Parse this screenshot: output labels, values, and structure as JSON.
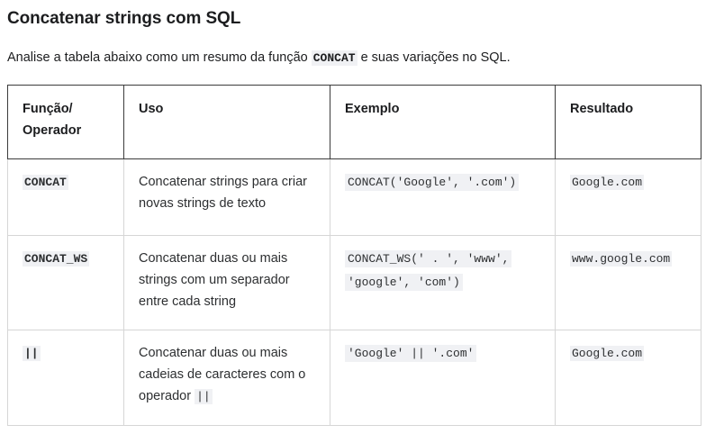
{
  "title": "Concatenar strings com SQL",
  "intro": {
    "before": "Analise a tabela abaixo como um resumo da função ",
    "code": "CONCAT",
    "after": " e suas variações no SQL."
  },
  "table": {
    "headers": [
      "Função/\nOperador",
      "Uso",
      "Exemplo",
      "Resultado"
    ],
    "rows": [
      {
        "function": "CONCAT",
        "usage": "Concatenar strings para criar novas strings de texto",
        "usage_code": "",
        "example": "CONCAT('Google', '.com')",
        "result": "Google.com"
      },
      {
        "function": "CONCAT_WS",
        "usage": "Concatenar duas ou mais strings com um separador entre cada string",
        "usage_code": "",
        "example": "CONCAT_WS(' . ', 'www', 'google', 'com')",
        "result": "www.google.com"
      },
      {
        "function": "||",
        "usage": "Concatenar duas ou mais cadeias de caracteres com o operador ",
        "usage_code": "||",
        "example": "'Google' || '.com'",
        "result": "Google.com"
      }
    ]
  }
}
